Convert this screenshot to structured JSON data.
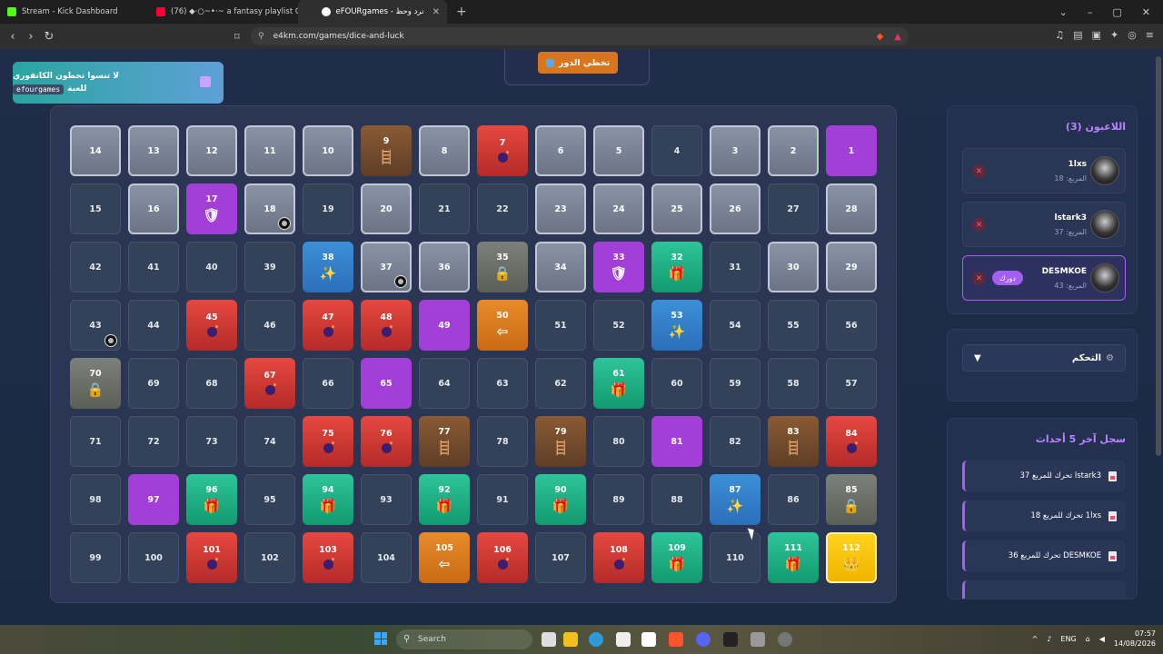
{
  "browser": {
    "tabs": [
      {
        "title": "Stream - Kick Dashboard",
        "color": "#53fc18"
      },
      {
        "title": "(76) ◆·○~•·~ a fantasy playlist C+",
        "color": "#ff0033"
      },
      {
        "title": "eFOURgames - نرد وحظ",
        "color": "#ffffff"
      }
    ],
    "new_tab": "+",
    "url": "e4km.com/games/dice-and-luck",
    "window_controls": [
      "⌄",
      "–",
      "▢",
      "✕"
    ]
  },
  "promo": {
    "line1": "لا تنسوا تحطون الكاتقوري",
    "line2_prefix": "للعبة",
    "code": "efourgames"
  },
  "turn_button": {
    "label": "تخطي الدور"
  },
  "board": {
    "cells": [
      {
        "n": "14",
        "t": "gray"
      },
      {
        "n": "13",
        "t": "gray"
      },
      {
        "n": "12",
        "t": "gray"
      },
      {
        "n": "11",
        "t": "gray"
      },
      {
        "n": "10",
        "t": "gray"
      },
      {
        "n": "9",
        "t": "brown",
        "s": "ladder"
      },
      {
        "n": "8",
        "t": "gray"
      },
      {
        "n": "7",
        "t": "red",
        "s": "bomb"
      },
      {
        "n": "6",
        "t": "gray"
      },
      {
        "n": "5",
        "t": "gray"
      },
      {
        "n": "4",
        "t": "dark"
      },
      {
        "n": "3",
        "t": "gray"
      },
      {
        "n": "2",
        "t": "gray"
      },
      {
        "n": "1",
        "t": "purple"
      },
      {
        "n": "15",
        "t": "dark"
      },
      {
        "n": "16",
        "t": "gray"
      },
      {
        "n": "17",
        "t": "purple",
        "s": "shield"
      },
      {
        "n": "18",
        "t": "gray",
        "p": true
      },
      {
        "n": "19",
        "t": "dark"
      },
      {
        "n": "20",
        "t": "gray"
      },
      {
        "n": "21",
        "t": "dark"
      },
      {
        "n": "22",
        "t": "dark"
      },
      {
        "n": "23",
        "t": "gray"
      },
      {
        "n": "24",
        "t": "gray"
      },
      {
        "n": "25",
        "t": "gray"
      },
      {
        "n": "26",
        "t": "gray"
      },
      {
        "n": "27",
        "t": "dark"
      },
      {
        "n": "28",
        "t": "gray"
      },
      {
        "n": "42",
        "t": "dark"
      },
      {
        "n": "41",
        "t": "dark"
      },
      {
        "n": "40",
        "t": "dark"
      },
      {
        "n": "39",
        "t": "dark"
      },
      {
        "n": "38",
        "t": "blue",
        "s": "sparkle"
      },
      {
        "n": "37",
        "t": "gray",
        "p": true
      },
      {
        "n": "36",
        "t": "gray"
      },
      {
        "n": "35",
        "t": "olive",
        "s": "lock"
      },
      {
        "n": "34",
        "t": "gray"
      },
      {
        "n": "33",
        "t": "purple",
        "s": "shield"
      },
      {
        "n": "32",
        "t": "green",
        "s": "gift"
      },
      {
        "n": "31",
        "t": "dark"
      },
      {
        "n": "30",
        "t": "gray"
      },
      {
        "n": "29",
        "t": "gray"
      },
      {
        "n": "43",
        "t": "dark",
        "p": true
      },
      {
        "n": "44",
        "t": "dark"
      },
      {
        "n": "45",
        "t": "red",
        "s": "bomb"
      },
      {
        "n": "46",
        "t": "dark"
      },
      {
        "n": "47",
        "t": "red",
        "s": "bomb"
      },
      {
        "n": "48",
        "t": "red",
        "s": "bomb"
      },
      {
        "n": "49",
        "t": "purple"
      },
      {
        "n": "50",
        "t": "orange",
        "s": "back"
      },
      {
        "n": "51",
        "t": "dark"
      },
      {
        "n": "52",
        "t": "dark"
      },
      {
        "n": "53",
        "t": "blue",
        "s": "sparkle"
      },
      {
        "n": "54",
        "t": "dark"
      },
      {
        "n": "55",
        "t": "dark"
      },
      {
        "n": "56",
        "t": "dark"
      },
      {
        "n": "70",
        "t": "olive",
        "s": "lock"
      },
      {
        "n": "69",
        "t": "dark"
      },
      {
        "n": "68",
        "t": "dark"
      },
      {
        "n": "67",
        "t": "red",
        "s": "bomb"
      },
      {
        "n": "66",
        "t": "dark"
      },
      {
        "n": "65",
        "t": "purple"
      },
      {
        "n": "64",
        "t": "dark"
      },
      {
        "n": "63",
        "t": "dark"
      },
      {
        "n": "62",
        "t": "dark"
      },
      {
        "n": "61",
        "t": "green",
        "s": "gift"
      },
      {
        "n": "60",
        "t": "dark"
      },
      {
        "n": "59",
        "t": "dark"
      },
      {
        "n": "58",
        "t": "dark"
      },
      {
        "n": "57",
        "t": "dark"
      },
      {
        "n": "71",
        "t": "dark"
      },
      {
        "n": "72",
        "t": "dark"
      },
      {
        "n": "73",
        "t": "dark"
      },
      {
        "n": "74",
        "t": "dark"
      },
      {
        "n": "75",
        "t": "red",
        "s": "bomb"
      },
      {
        "n": "76",
        "t": "red",
        "s": "bomb"
      },
      {
        "n": "77",
        "t": "brown",
        "s": "ladder"
      },
      {
        "n": "78",
        "t": "dark"
      },
      {
        "n": "79",
        "t": "brown",
        "s": "ladder"
      },
      {
        "n": "80",
        "t": "dark"
      },
      {
        "n": "81",
        "t": "purple"
      },
      {
        "n": "82",
        "t": "dark"
      },
      {
        "n": "83",
        "t": "brown",
        "s": "ladder"
      },
      {
        "n": "84",
        "t": "red",
        "s": "bomb"
      },
      {
        "n": "98",
        "t": "dark"
      },
      {
        "n": "97",
        "t": "purple"
      },
      {
        "n": "96",
        "t": "green",
        "s": "gift"
      },
      {
        "n": "95",
        "t": "dark"
      },
      {
        "n": "94",
        "t": "green",
        "s": "gift"
      },
      {
        "n": "93",
        "t": "dark"
      },
      {
        "n": "92",
        "t": "green",
        "s": "gift"
      },
      {
        "n": "91",
        "t": "dark"
      },
      {
        "n": "90",
        "t": "green",
        "s": "gift"
      },
      {
        "n": "89",
        "t": "dark"
      },
      {
        "n": "88",
        "t": "dark"
      },
      {
        "n": "87",
        "t": "blue",
        "s": "sparkle"
      },
      {
        "n": "86",
        "t": "dark"
      },
      {
        "n": "85",
        "t": "olive",
        "s": "lock"
      },
      {
        "n": "99",
        "t": "dark"
      },
      {
        "n": "100",
        "t": "dark"
      },
      {
        "n": "101",
        "t": "red",
        "s": "bomb"
      },
      {
        "n": "102",
        "t": "dark"
      },
      {
        "n": "103",
        "t": "red",
        "s": "bomb"
      },
      {
        "n": "104",
        "t": "dark"
      },
      {
        "n": "105",
        "t": "orange",
        "s": "back"
      },
      {
        "n": "106",
        "t": "red",
        "s": "bomb"
      },
      {
        "n": "107",
        "t": "dark"
      },
      {
        "n": "108",
        "t": "red",
        "s": "bomb"
      },
      {
        "n": "109",
        "t": "green",
        "s": "gift"
      },
      {
        "n": "110",
        "t": "dark"
      },
      {
        "n": "111",
        "t": "green",
        "s": "gift"
      },
      {
        "n": "112",
        "t": "yellow",
        "s": "crown"
      }
    ]
  },
  "players_panel": {
    "title": "اللاعبون (3)",
    "players": [
      {
        "name": "1lxs",
        "square": "المربع: 18",
        "turn": false
      },
      {
        "name": "lstark3",
        "square": "المربع: 37",
        "turn": false
      },
      {
        "name": "DESMKOE",
        "square": "المربع: 43",
        "turn": true,
        "badge": "دورك"
      }
    ]
  },
  "controls_panel": {
    "label": "التحكم"
  },
  "log_panel": {
    "title": "سجل آخر 5 أحداث",
    "items": [
      "lstark3 تحرك للمربع 37",
      "1lxs تحرك للمربع 18",
      "DESMKOE تحرك للمربع 36"
    ]
  },
  "taskbar": {
    "search": "Search",
    "lang": "ENG",
    "time": "07:57",
    "date": "14/08/2026"
  }
}
